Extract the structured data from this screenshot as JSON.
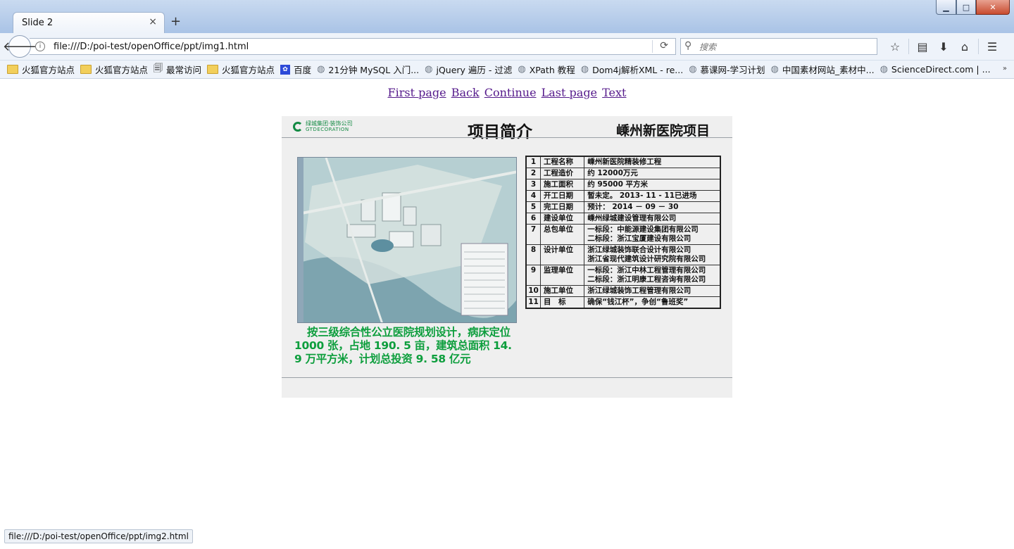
{
  "window": {
    "tab_title": "Slide 2",
    "close_tab": "×",
    "new_tab": "+",
    "min": "▁",
    "max": "□",
    "close": "✕"
  },
  "navbar": {
    "url": "file:///D:/poi-test/openOffice/ppt/img1.html",
    "search_placeholder": "搜索",
    "info_icon": "i"
  },
  "bookmarks": [
    {
      "label": "火狐官方站点",
      "icon": "folder-icon"
    },
    {
      "label": "火狐官方站点",
      "icon": "folder-icon"
    },
    {
      "label": "最常访问",
      "icon": "history-icon"
    },
    {
      "label": "火狐官方站点",
      "icon": "folder-icon"
    },
    {
      "label": "百度",
      "icon": "paw-icon"
    },
    {
      "label": "21分钟 MySQL 入门...",
      "icon": "globe-icon"
    },
    {
      "label": "jQuery 遍历 - 过滤",
      "icon": "globe-icon"
    },
    {
      "label": "XPath 教程",
      "icon": "globe-icon"
    },
    {
      "label": "Dom4j解析XML - re...",
      "icon": "globe-icon"
    },
    {
      "label": "慕课网-学习计划",
      "icon": "globe-icon"
    },
    {
      "label": "中国素材网站_素材中...",
      "icon": "globe-icon"
    },
    {
      "label": "ScienceDirect.com | ...",
      "icon": "globe-icon"
    }
  ],
  "page": {
    "nav_links": {
      "first": "First page",
      "back": "Back",
      "continue": "Continue",
      "last": "Last page",
      "text": "Text"
    },
    "slide": {
      "logo_cn": "绿城集团·装饰公司",
      "logo_en": "GTDECORATION",
      "title": "项目简介",
      "project": "嵊州新医院项目",
      "caption": "按三级综合性公立医院规划设计，病床定位 1000 张，占地 190. 5 亩，建筑总面积 14. 9 万平方米，计划总投资 9. 58 亿元",
      "table": [
        {
          "no": "1",
          "label": "工程名称",
          "value": "嵊州新医院精装修工程"
        },
        {
          "no": "2",
          "label": "工程造价",
          "value": "约 12000万元"
        },
        {
          "no": "3",
          "label": "施工面积",
          "value": "约 95000 平方米"
        },
        {
          "no": "4",
          "label": "开工日期",
          "value": "暂未定。 2013- 11 - 11已进场"
        },
        {
          "no": "5",
          "label": "完工日期",
          "value": "预计： 2014 － 09 － 30"
        },
        {
          "no": "6",
          "label": "建设单位",
          "value": "嵊州绿城建设管理有限公司"
        },
        {
          "no": "7",
          "label": "总包单位",
          "value": "一标段：中能源建设集团有限公司　　　　　　　二标段：浙江宝厦建设有限公司"
        },
        {
          "no": "8",
          "label": "设计单位",
          "value": "浙江绿城装饰联合设计有限公司　　　　　　　浙江省现代建筑设计研究院有限公司"
        },
        {
          "no": "9",
          "label": "监理单位",
          "value": "一标段：浙江中林工程管理有限公司　　　　　　　二标段：浙江明康工程咨询有限公司"
        },
        {
          "no": "10",
          "label": "施工单位",
          "value": "浙江绿城装饰工程管理有限公司"
        },
        {
          "no": "11",
          "label": "目　标",
          "value": "确保“钱江杯”，争创“鲁班奖”"
        }
      ]
    }
  },
  "statusbar": {
    "text": "file:///D:/poi-test/openOffice/ppt/img2.html"
  },
  "colors": {
    "caption_green": "#0d9e3d",
    "link_visited": "#551a8b",
    "slide_bg": "#efefef"
  }
}
